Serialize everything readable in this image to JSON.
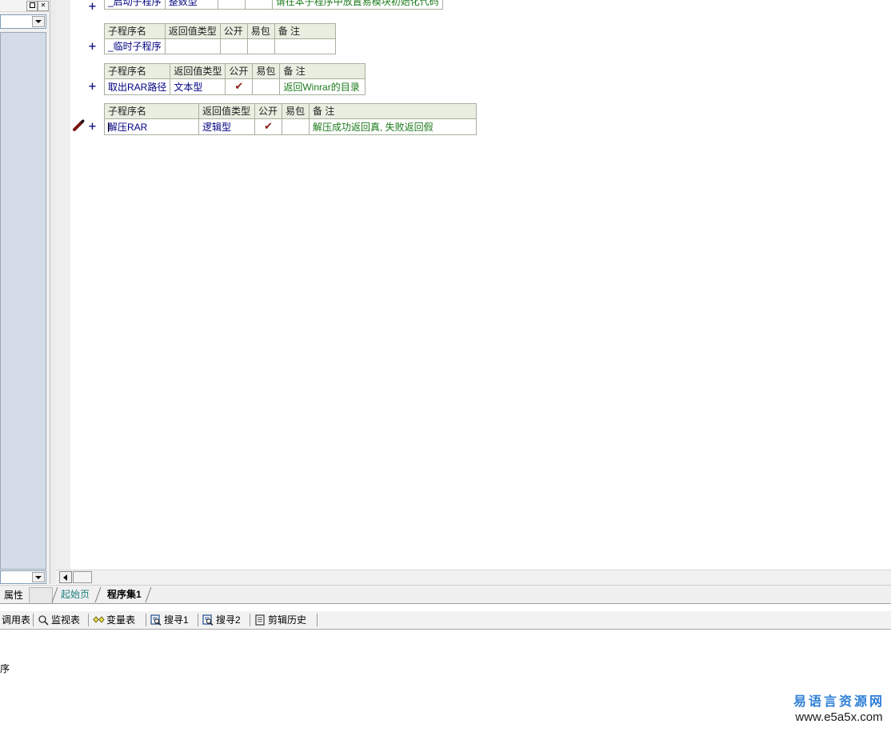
{
  "properties_panel": {
    "title_label": "属性",
    "maximize_icon": "maximize-icon",
    "close_icon": "close-icon",
    "combo_value": "",
    "combo_arrow_icon": "chevron-down-icon",
    "bottom_combo_value": "",
    "bottom_combo_arrow_icon": "chevron-down-icon"
  },
  "editor": {
    "expander_symbol": "+",
    "pen_icon": "pen-icon",
    "columns": [
      "子程序名",
      "返回值类型",
      "公开",
      "易包",
      "备 注"
    ],
    "check_glyph": "✔",
    "tables": [
      {
        "id": "table-startup",
        "header_visible": false,
        "rows": [
          {
            "name": "_启动子程序",
            "return_type": "整数型",
            "public": "",
            "package": "",
            "note": "请在本子程序中放置易模块初始化代码"
          }
        ]
      },
      {
        "id": "table-temp",
        "header_visible": true,
        "rows": [
          {
            "name": "_临时子程序",
            "return_type": "",
            "public": "",
            "package": "",
            "note": ""
          }
        ]
      },
      {
        "id": "table-getrarpath",
        "header_visible": true,
        "rows": [
          {
            "name": "取出RAR路径",
            "return_type": "文本型",
            "public": "✔",
            "package": "",
            "note": "返回Winrar的目录"
          }
        ]
      },
      {
        "id": "table-unrar",
        "header_visible": true,
        "rows": [
          {
            "name": "解压RAR",
            "return_type": "逻辑型",
            "public": "✔",
            "package": "",
            "note": "解压成功返回真, 失败返回假"
          }
        ]
      }
    ]
  },
  "hscrollbar": {
    "left_arrow_icon": "triangle-left-icon"
  },
  "document_tabs": [
    {
      "label": "起始页",
      "active": false
    },
    {
      "label": "程序集1",
      "active": true
    }
  ],
  "tool_tabs": [
    {
      "label": "调用表",
      "icon": ""
    },
    {
      "label": "监视表",
      "icon": "magnifier-icon"
    },
    {
      "label": "变量表",
      "icon": "diamonds-icon"
    },
    {
      "label": "搜寻1",
      "icon": "find-page-icon"
    },
    {
      "label": "搜寻2",
      "icon": "find-page-icon"
    },
    {
      "label": "剪辑历史",
      "icon": "clipboard-list-icon"
    }
  ],
  "bottom_pane": {
    "partial_text": "序"
  },
  "watermark": {
    "chinese": "易语言资源网",
    "url": "www.e5a5x.com"
  },
  "colors": {
    "header_bg": "#e9eee0",
    "name_text": "#000080",
    "note_text": "#1a7a1a",
    "check_mark": "#8b1a1a",
    "props_list_bg": "#d4dce8",
    "watermark_blue": "#2f7fd6",
    "inactive_tab": "#208080"
  }
}
